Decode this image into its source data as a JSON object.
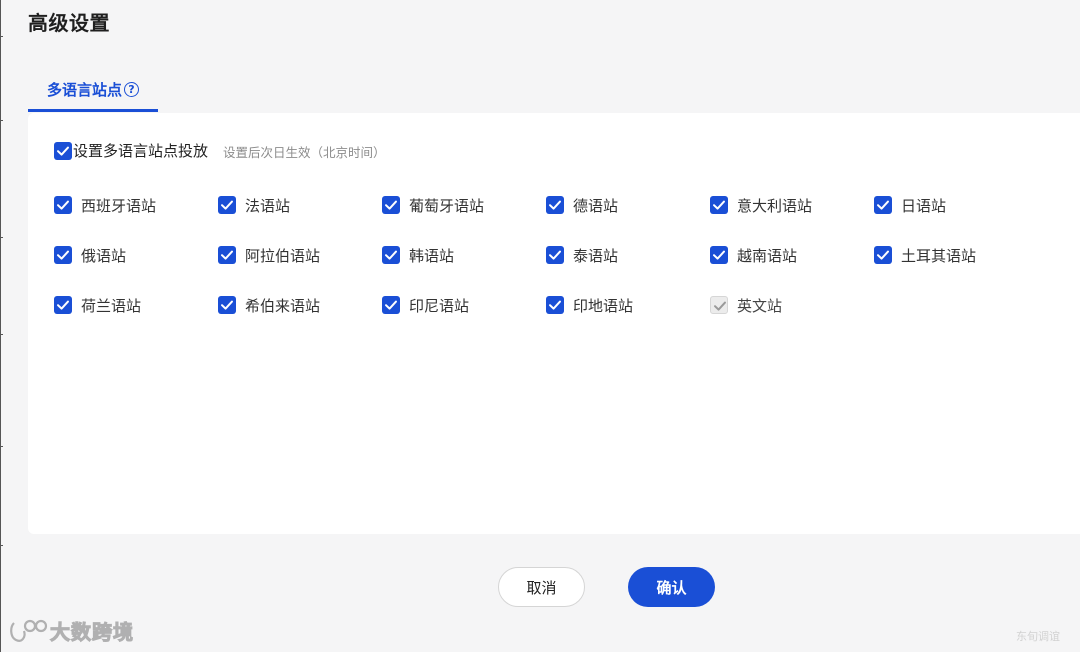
{
  "dialog": {
    "title": "高级设置"
  },
  "tab": {
    "label": "多语言站点",
    "help_icon": "question-circle-icon",
    "accent_color": "#1a4fd6"
  },
  "master_option": {
    "label": "设置多语言站点投放",
    "checked": true,
    "hint": "设置后次日生效（北京时间）"
  },
  "sites": [
    {
      "label": "西班牙语站",
      "checked": true,
      "disabled": false
    },
    {
      "label": "法语站",
      "checked": true,
      "disabled": false
    },
    {
      "label": "葡萄牙语站",
      "checked": true,
      "disabled": false
    },
    {
      "label": "德语站",
      "checked": true,
      "disabled": false
    },
    {
      "label": "意大利语站",
      "checked": true,
      "disabled": false
    },
    {
      "label": "日语站",
      "checked": true,
      "disabled": false
    },
    {
      "label": "俄语站",
      "checked": true,
      "disabled": false
    },
    {
      "label": "阿拉伯语站",
      "checked": true,
      "disabled": false
    },
    {
      "label": "韩语站",
      "checked": true,
      "disabled": false
    },
    {
      "label": "泰语站",
      "checked": true,
      "disabled": false
    },
    {
      "label": "越南语站",
      "checked": true,
      "disabled": false
    },
    {
      "label": "土耳其语站",
      "checked": true,
      "disabled": false
    },
    {
      "label": "荷兰语站",
      "checked": true,
      "disabled": false
    },
    {
      "label": "希伯来语站",
      "checked": true,
      "disabled": false
    },
    {
      "label": "印尼语站",
      "checked": true,
      "disabled": false
    },
    {
      "label": "印地语站",
      "checked": true,
      "disabled": false
    },
    {
      "label": "英文站",
      "checked": true,
      "disabled": true
    }
  ],
  "buttons": {
    "cancel": "取消",
    "confirm": "确认"
  },
  "watermark": {
    "text": "大数跨境",
    "corner_text": "东旬调谊"
  }
}
